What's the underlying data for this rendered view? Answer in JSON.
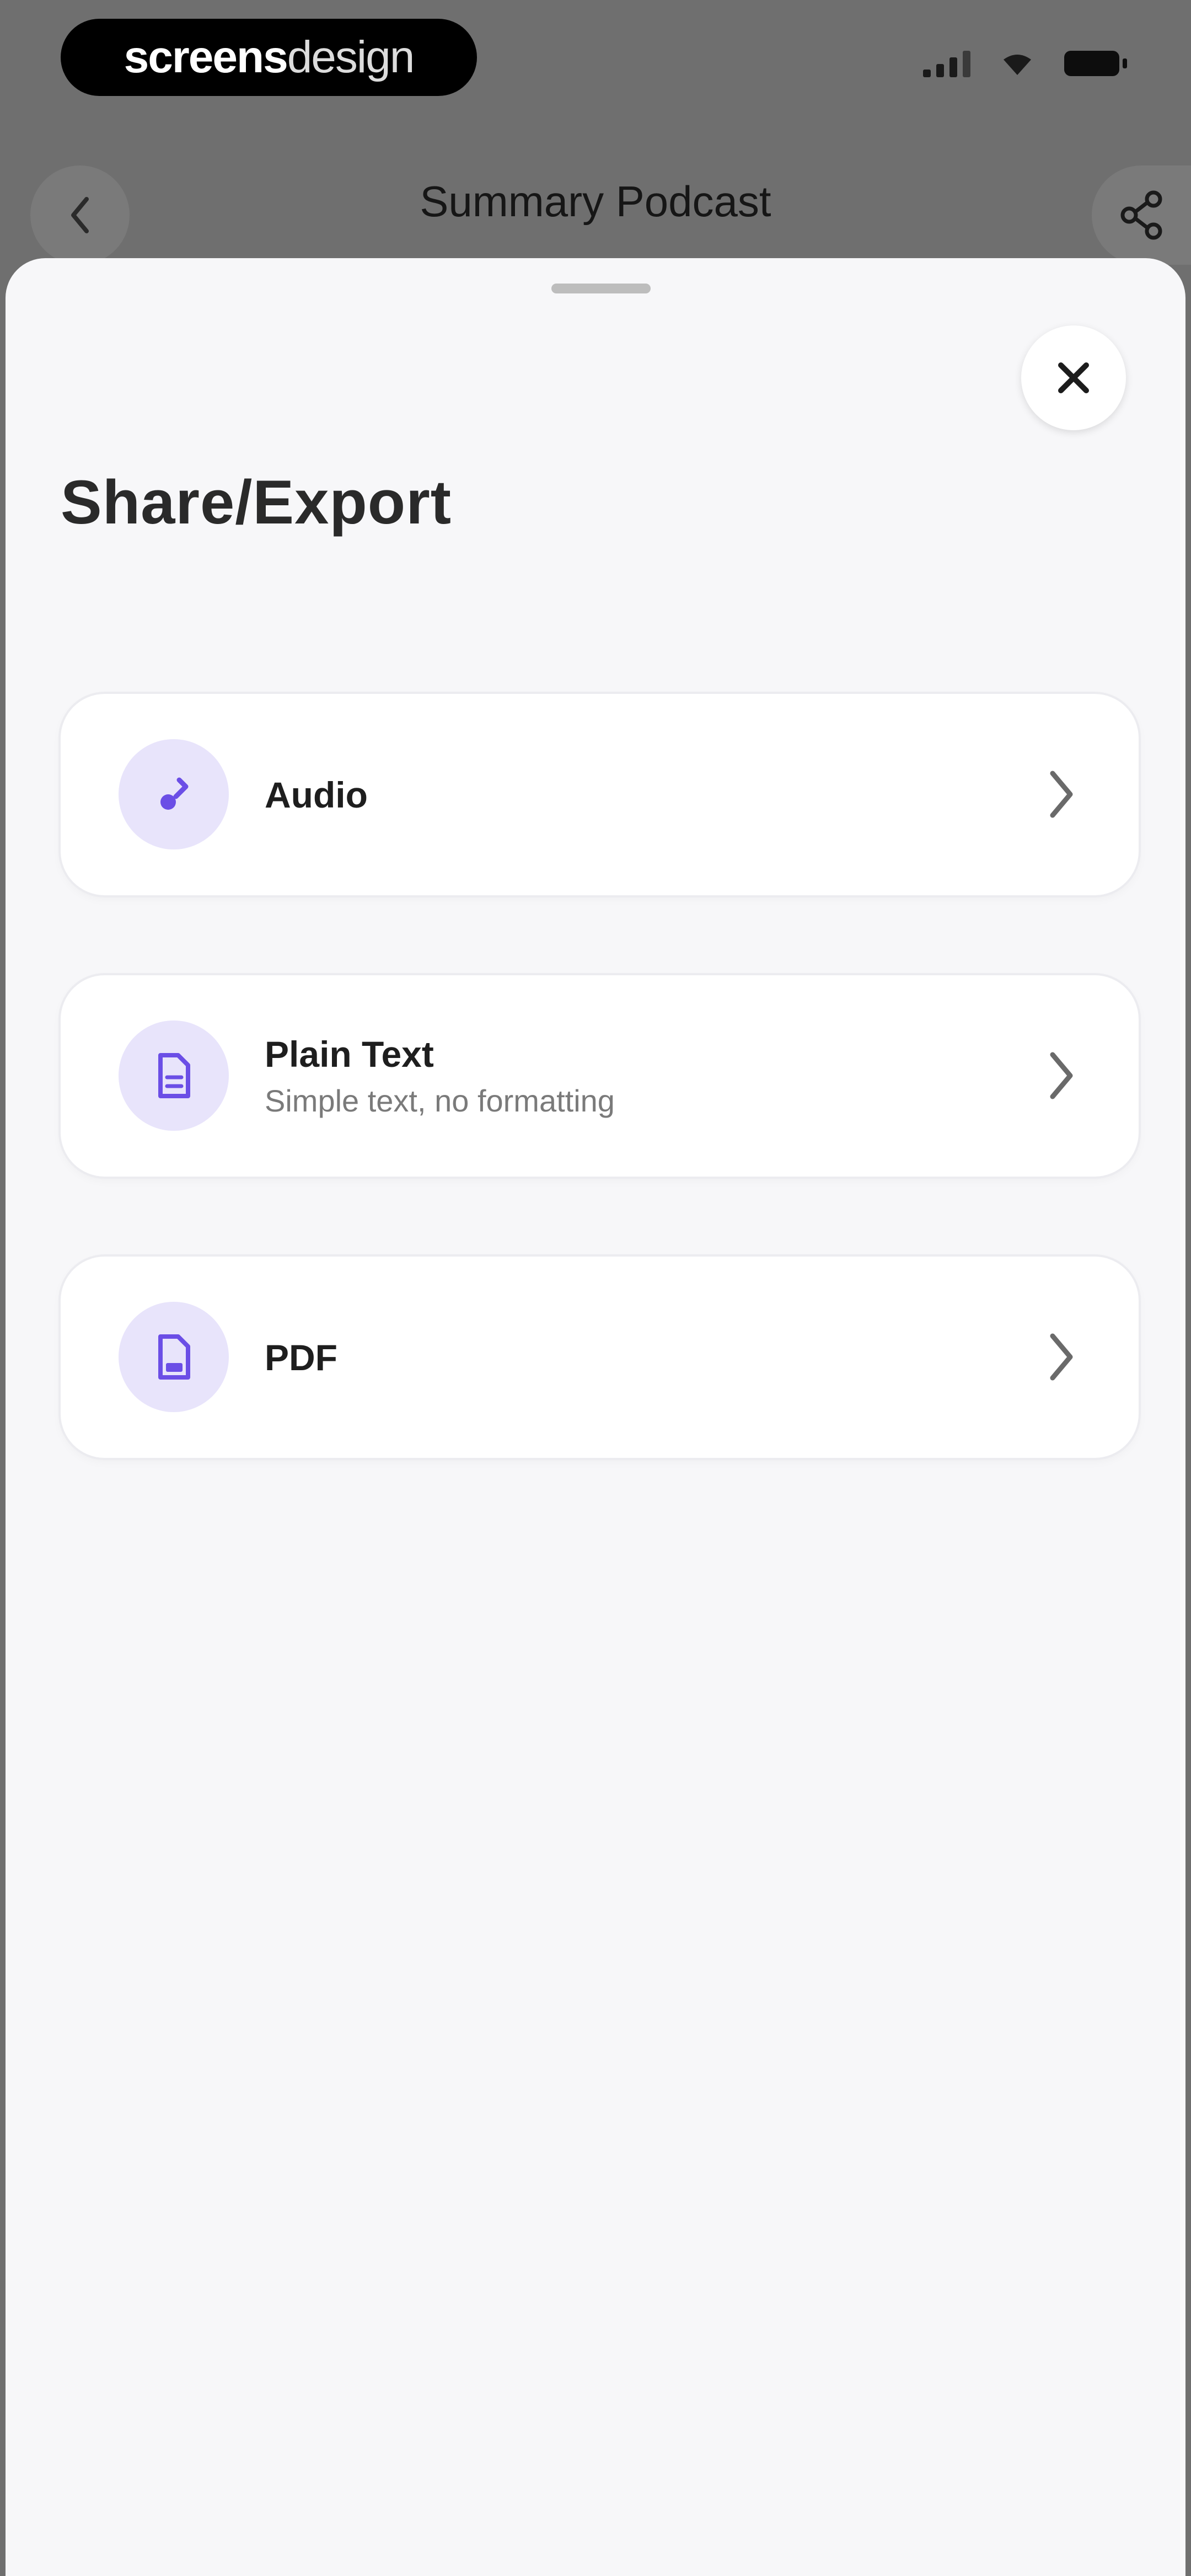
{
  "status_bar": {
    "brand_bold": "screens",
    "brand_light": "design"
  },
  "background_nav": {
    "title": "Summary Podcast"
  },
  "sheet": {
    "title": "Share/Export",
    "options": [
      {
        "title": "Audio",
        "subtitle": "",
        "icon": "music-note-icon"
      },
      {
        "title": "Plain Text",
        "subtitle": "Simple text, no formatting",
        "icon": "text-document-icon"
      },
      {
        "title": "PDF",
        "subtitle": "",
        "icon": "pdf-document-icon"
      }
    ]
  },
  "colors": {
    "accent": "#6b4ee6",
    "icon_bg": "#e8e4fb",
    "sheet_bg": "#f7f7f9"
  }
}
